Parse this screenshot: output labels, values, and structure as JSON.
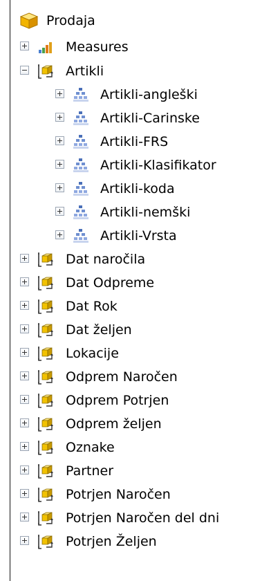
{
  "tree": {
    "root": {
      "label": "Prodaja",
      "icon": "cube-icon"
    },
    "measures": {
      "label": "Measures",
      "icon": "measures-icon",
      "state": "collapsed"
    },
    "artikli": {
      "label": "Artikli",
      "icon": "dimension-icon",
      "state": "expanded",
      "hierarchies": [
        {
          "label": "Artikli-angleški",
          "icon": "hierarchy-icon"
        },
        {
          "label": "Artikli-Carinske",
          "icon": "hierarchy-icon"
        },
        {
          "label": "Artikli-FRS",
          "icon": "hierarchy-icon"
        },
        {
          "label": "Artikli-Klasifikator",
          "icon": "hierarchy-icon"
        },
        {
          "label": "Artikli-koda",
          "icon": "hierarchy-icon"
        },
        {
          "label": "Artikli-nemški",
          "icon": "hierarchy-icon"
        },
        {
          "label": "Artikli-Vrsta",
          "icon": "hierarchy-icon"
        }
      ]
    },
    "dimensions": [
      {
        "label": "Dat naročila",
        "icon": "dimension-icon"
      },
      {
        "label": "Dat Odpreme",
        "icon": "dimension-icon"
      },
      {
        "label": "Dat Rok",
        "icon": "dimension-icon"
      },
      {
        "label": "Dat željen",
        "icon": "dimension-icon"
      },
      {
        "label": "Lokacije",
        "icon": "dimension-icon"
      },
      {
        "label": "Odprem Naročen",
        "icon": "dimension-icon"
      },
      {
        "label": "Odprem Potrjen",
        "icon": "dimension-icon"
      },
      {
        "label": "Odprem željen",
        "icon": "dimension-icon"
      },
      {
        "label": "Oznake",
        "icon": "dimension-icon"
      },
      {
        "label": "Partner",
        "icon": "dimension-icon"
      },
      {
        "label": "Potrjen Naročen",
        "icon": "dimension-icon"
      },
      {
        "label": "Potrjen Naročen del dni",
        "icon": "dimension-icon"
      },
      {
        "label": "Potrjen Željen",
        "icon": "dimension-icon"
      }
    ]
  }
}
